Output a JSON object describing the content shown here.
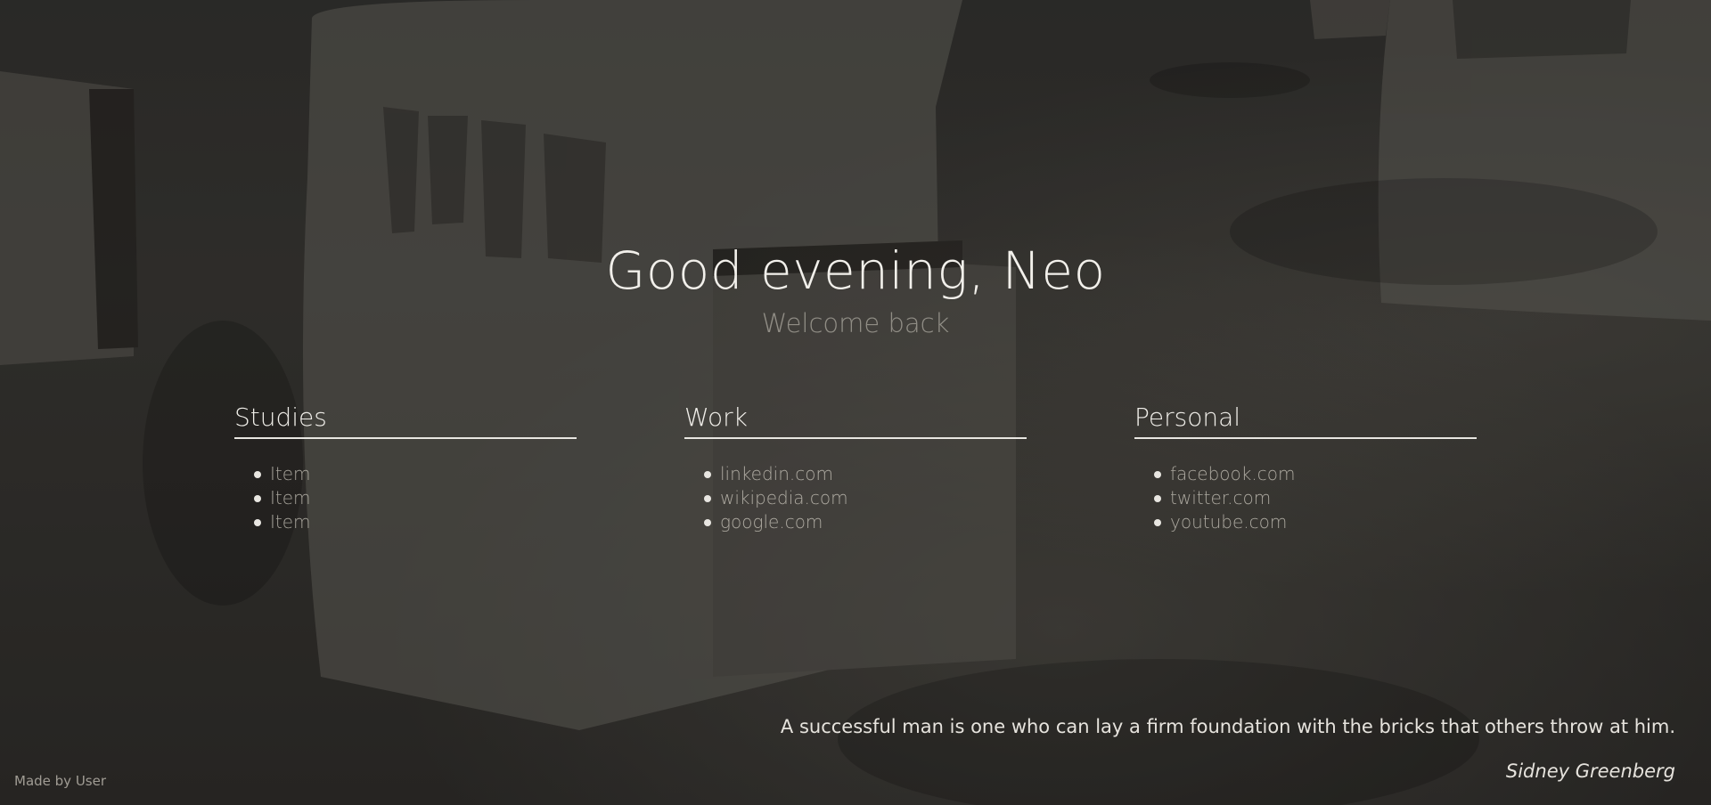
{
  "greeting": "Good evening, Neo",
  "subtitle": "Welcome back",
  "columns": [
    {
      "title": "Studies",
      "items": [
        "Item",
        "Item",
        "Item"
      ]
    },
    {
      "title": "Work",
      "items": [
        "linkedin.com",
        "wikipedia.com",
        "google.com"
      ]
    },
    {
      "title": "Personal",
      "items": [
        "facebook.com",
        "twitter.com",
        "youtube.com"
      ]
    }
  ],
  "quote": {
    "text": "A successful man is one who can lay a firm foundation with the bricks that others throw at him.",
    "author": "Sidney Greenberg"
  },
  "footer": "Made by User",
  "colors": {
    "text": "#e8e6e1",
    "muted": "#c8c3b9",
    "background": "#3a3936"
  }
}
